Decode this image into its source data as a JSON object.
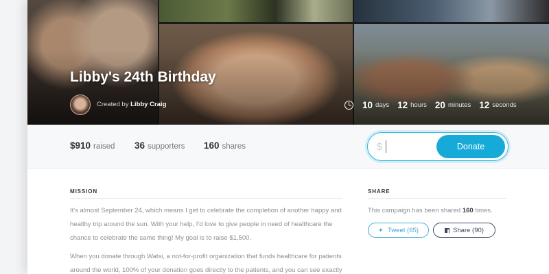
{
  "campaign": {
    "title": "Libby's 24th Birthday",
    "created_by_prefix": "Created by",
    "creator_name": "Libby Craig"
  },
  "countdown": {
    "days_value": "10",
    "days_label": "days",
    "hours_value": "12",
    "hours_label": "hours",
    "minutes_value": "20",
    "minutes_label": "minutes",
    "seconds_value": "12",
    "seconds_label": "seconds"
  },
  "stats": {
    "raised_value": "$910",
    "raised_label": "raised",
    "supporters_value": "36",
    "supporters_label": "supporters",
    "shares_value": "160",
    "shares_label": "shares"
  },
  "donate": {
    "currency_symbol": "$",
    "amount_value": "",
    "button_label": "Donate"
  },
  "mission": {
    "heading": "MISSION",
    "paragraph1": "It's almost September 24, which means I get to celebrate the completion of another happy and healthy trip around the sun. With your help, I'd love to give people in need of healthcare the chance to celebrate the same thing! My goal is to raise $1,500.",
    "paragraph2": "When you donate through Watsi, a not-for-profit organization that funds healthcare for patients around the world, 100% of your donation goes directly to the patients, and you can see exactly"
  },
  "share": {
    "heading": "SHARE",
    "text_prefix": "This campaign has been shared",
    "count": "160",
    "text_suffix": "times.",
    "tweet_label": "Tweet (65)",
    "facebook_label": "Share (90)"
  },
  "colors": {
    "accent": "#16aad8",
    "twitter": "#41a9d9",
    "facebook": "#3b4a64"
  },
  "icons": [
    "clock-icon",
    "twitter-bird-icon",
    "facebook-icon"
  ]
}
